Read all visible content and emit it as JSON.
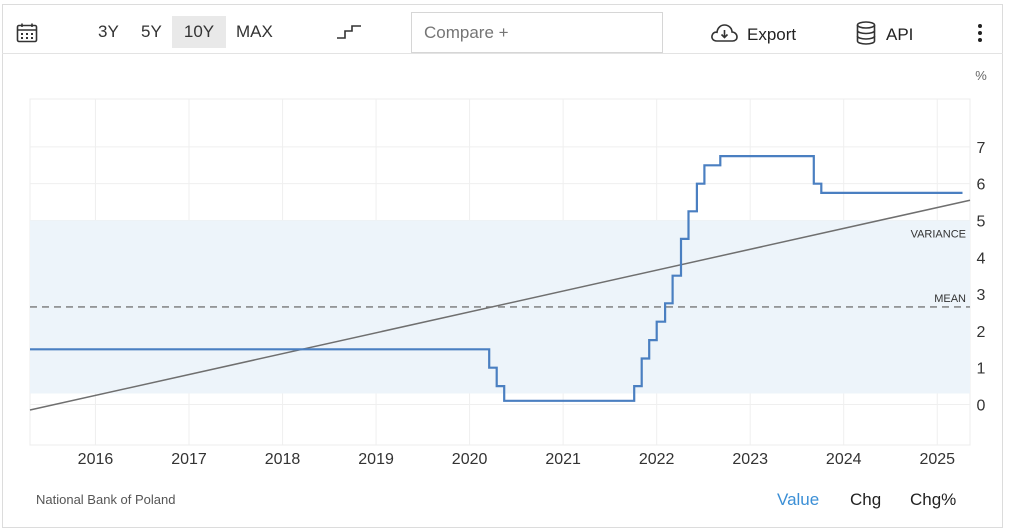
{
  "toolbar": {
    "ranges": [
      "3Y",
      "5Y",
      "10Y",
      "MAX"
    ],
    "active_range": "10Y",
    "compare_placeholder": "Compare +",
    "export_label": "Export",
    "api_label": "API",
    "icons": [
      "calendar-icon",
      "step-chart-icon",
      "cloud-download-icon",
      "database-icon",
      "more-vertical-icon"
    ]
  },
  "chart_data": {
    "type": "line",
    "unit_label": "%",
    "y_ticks": [
      "0",
      "1",
      "2",
      "3",
      "4",
      "5",
      "6",
      "7"
    ],
    "x_ticks": [
      "2016",
      "2017",
      "2018",
      "2019",
      "2020",
      "2021",
      "2022",
      "2023",
      "2024",
      "2025"
    ],
    "ylim": [
      -1.1,
      8.3
    ],
    "xlim": [
      2015.3,
      2025.35
    ],
    "grid": true,
    "series": [
      {
        "color": "#4a7fc1",
        "step": true,
        "points": [
          [
            2015.3,
            1.5
          ],
          [
            2020.21,
            1.5
          ],
          [
            2020.21,
            1.0
          ],
          [
            2020.29,
            1.0
          ],
          [
            2020.29,
            0.5
          ],
          [
            2020.37,
            0.5
          ],
          [
            2020.37,
            0.1
          ],
          [
            2021.76,
            0.1
          ],
          [
            2021.76,
            0.5
          ],
          [
            2021.84,
            0.5
          ],
          [
            2021.84,
            1.25
          ],
          [
            2021.92,
            1.25
          ],
          [
            2021.92,
            1.75
          ],
          [
            2022.0,
            1.75
          ],
          [
            2022.0,
            2.25
          ],
          [
            2022.09,
            2.25
          ],
          [
            2022.09,
            2.75
          ],
          [
            2022.17,
            2.75
          ],
          [
            2022.17,
            3.5
          ],
          [
            2022.26,
            3.5
          ],
          [
            2022.26,
            4.5
          ],
          [
            2022.34,
            4.5
          ],
          [
            2022.34,
            5.25
          ],
          [
            2022.43,
            5.25
          ],
          [
            2022.43,
            6.0
          ],
          [
            2022.51,
            6.0
          ],
          [
            2022.51,
            6.5
          ],
          [
            2022.68,
            6.5
          ],
          [
            2022.68,
            6.75
          ],
          [
            2023.68,
            6.75
          ],
          [
            2023.68,
            6.0
          ],
          [
            2023.76,
            6.0
          ],
          [
            2023.76,
            5.75
          ],
          [
            2025.27,
            5.75
          ]
        ]
      }
    ],
    "trend_line": {
      "color": "#6f6f6f",
      "from": [
        2015.3,
        -0.15
      ],
      "to": [
        2025.35,
        5.55
      ]
    },
    "mean": {
      "label": "MEAN",
      "value": 2.65
    },
    "variance": {
      "label": "VARIANCE",
      "range": [
        0.3,
        5.0
      ],
      "color": "#edf4fa"
    }
  },
  "footer": {
    "source": "National Bank of Poland",
    "tabs": [
      "Value",
      "Chg",
      "Chg%"
    ],
    "active_tab": "Value"
  }
}
